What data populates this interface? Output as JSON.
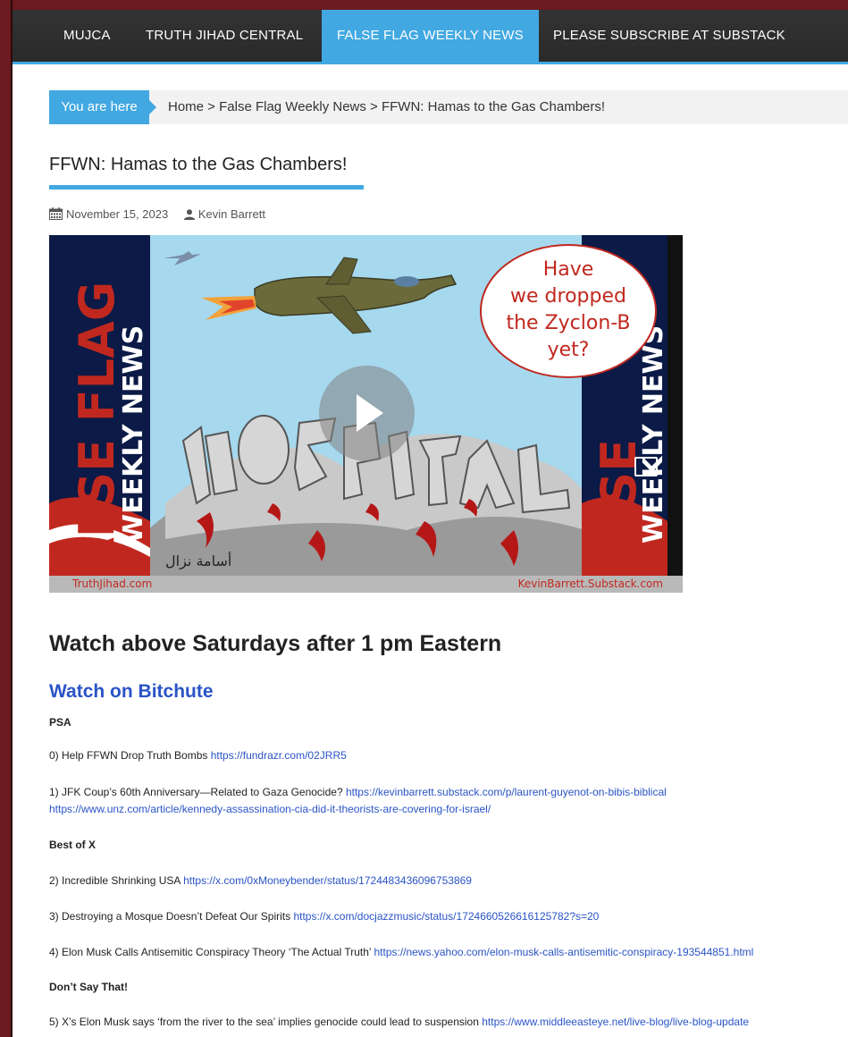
{
  "nav": {
    "items": [
      {
        "label": "MUJCA"
      },
      {
        "label": "TRUTH JIHAD CENTRAL"
      },
      {
        "label": "FALSE FLAG WEEKLY NEWS"
      },
      {
        "label": "PLEASE SUBSCRIBE AT SUBSTACK"
      }
    ],
    "active_index": 2
  },
  "breadcrumb": {
    "label": "You are here",
    "path": "Home > False Flag Weekly News > FFWN: Hamas to the Gas Chambers!"
  },
  "post": {
    "title": "FFWN: Hamas to the Gas Chambers!",
    "date": "November 15, 2023",
    "author": "Kevin Barrett",
    "date_icon": "calendar-icon",
    "author_icon": "user-icon"
  },
  "video": {
    "bubble_lines": [
      "Have",
      "we dropped",
      "the Zyclon-B",
      "yet?"
    ],
    "footer_left": "TruthJihad.com",
    "footer_right": "KevinBarrett.Substack.com",
    "banner_text": "FALSE FLAG WEEKLY NEWS"
  },
  "content": {
    "watch_heading": "Watch above Saturdays after 1 pm Eastern",
    "bitchute_link": "Watch on Bitchute",
    "psa_heading": "PSA",
    "item0": {
      "text": "0) Help FFWN Drop Truth Bombs ",
      "link": "https://fundrazr.com/02JRR5"
    },
    "item1": {
      "text": "1) JFK Coup’s 60th Anniversary—Related to Gaza Genocide? ",
      "link": "https://kevinbarrett.substack.com/p/laurent-guyenot-on-bibis-biblical",
      "link2": "https://www.unz.com/article/kennedy-assassination-cia-did-it-theorists-are-covering-for-israel/"
    },
    "best_heading": "Best of X",
    "item2": {
      "text": "2) Incredible Shrinking USA ",
      "link": "https://x.com/0xMoneybender/status/1724483436096753869"
    },
    "item3": {
      "text": "3) Destroying a Mosque Doesn’t Defeat Our Spirits ",
      "link": "https://x.com/docjazzmusic/status/1724660526616125782?s=20"
    },
    "item4": {
      "text": "4) Elon Musk Calls Antisemitic Conspiracy Theory ‘The Actual Truth’ ",
      "link": "https://news.yahoo.com/elon-musk-calls-antisemitic-conspiracy-193544851.html"
    },
    "dont_heading": "Don’t Say That!",
    "item5": {
      "text": "5) X’s Elon Musk says ‘from the river to the sea’ implies genocide could lead to suspension ",
      "link": "https://www.middleeasteye.net/live-blog/live-blog-update"
    }
  },
  "colors": {
    "accent": "#41a8e2",
    "link": "#2a54c6",
    "border": "#6b1a1f"
  }
}
